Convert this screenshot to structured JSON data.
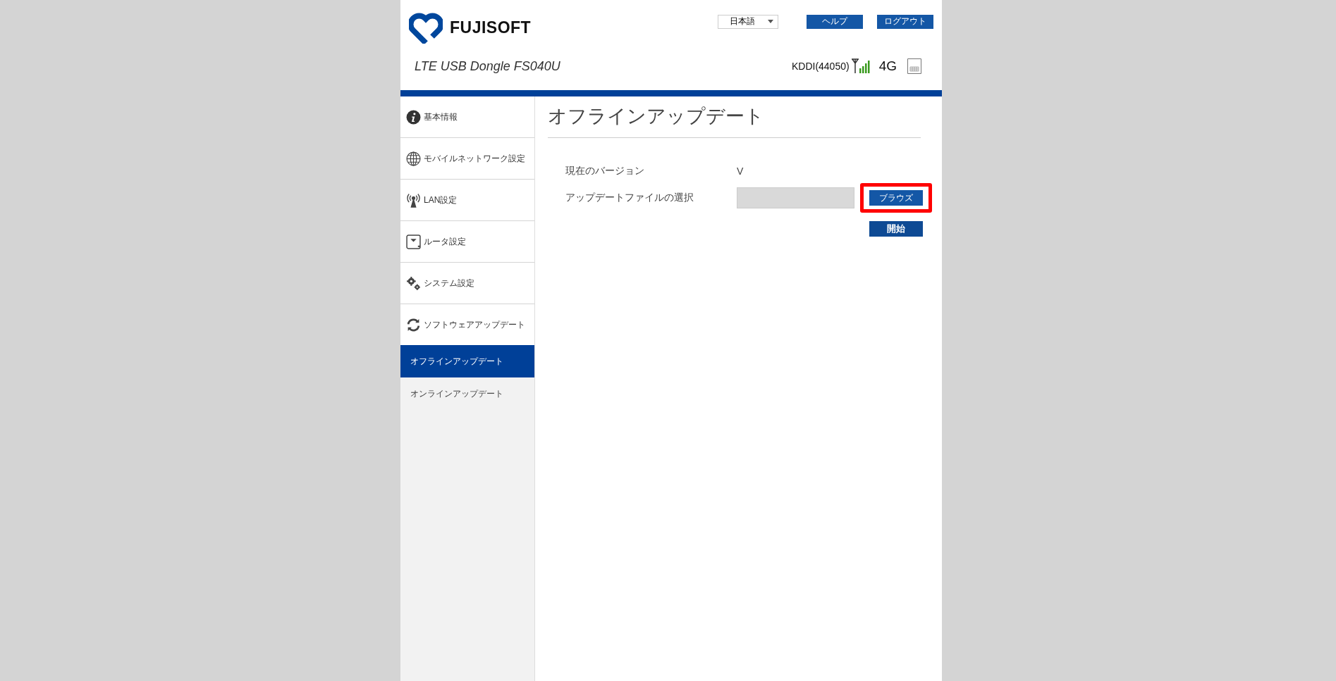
{
  "header": {
    "logo_text": "FUJISOFT",
    "language": "日本語",
    "buttons": [
      "ヘルプ",
      "ログアウト"
    ],
    "device_name": "LTE USB Dongle FS040U",
    "carrier": "KDDI(44050)",
    "network_type": "4G"
  },
  "sidebar": {
    "items": [
      {
        "label": "基本情報",
        "expanded": false
      },
      {
        "label": "モバイルネットワーク設定",
        "expanded": false
      },
      {
        "label": "LAN設定",
        "expanded": false
      },
      {
        "label": "ルータ設定",
        "expanded": false
      },
      {
        "label": "システム設定",
        "expanded": false
      },
      {
        "label": "ソフトウェアアップデート",
        "expanded": true,
        "children": [
          {
            "label": "オフラインアップデート",
            "selected": true
          },
          {
            "label": "オンラインアップデート",
            "selected": false
          }
        ]
      }
    ]
  },
  "content": {
    "title": "オフラインアップデート",
    "version_label": "現在のバージョン",
    "version_value": "V",
    "file_label": "アップデートファイルの選択",
    "browse_button": "ブラウズ",
    "start_button": "開始"
  }
}
